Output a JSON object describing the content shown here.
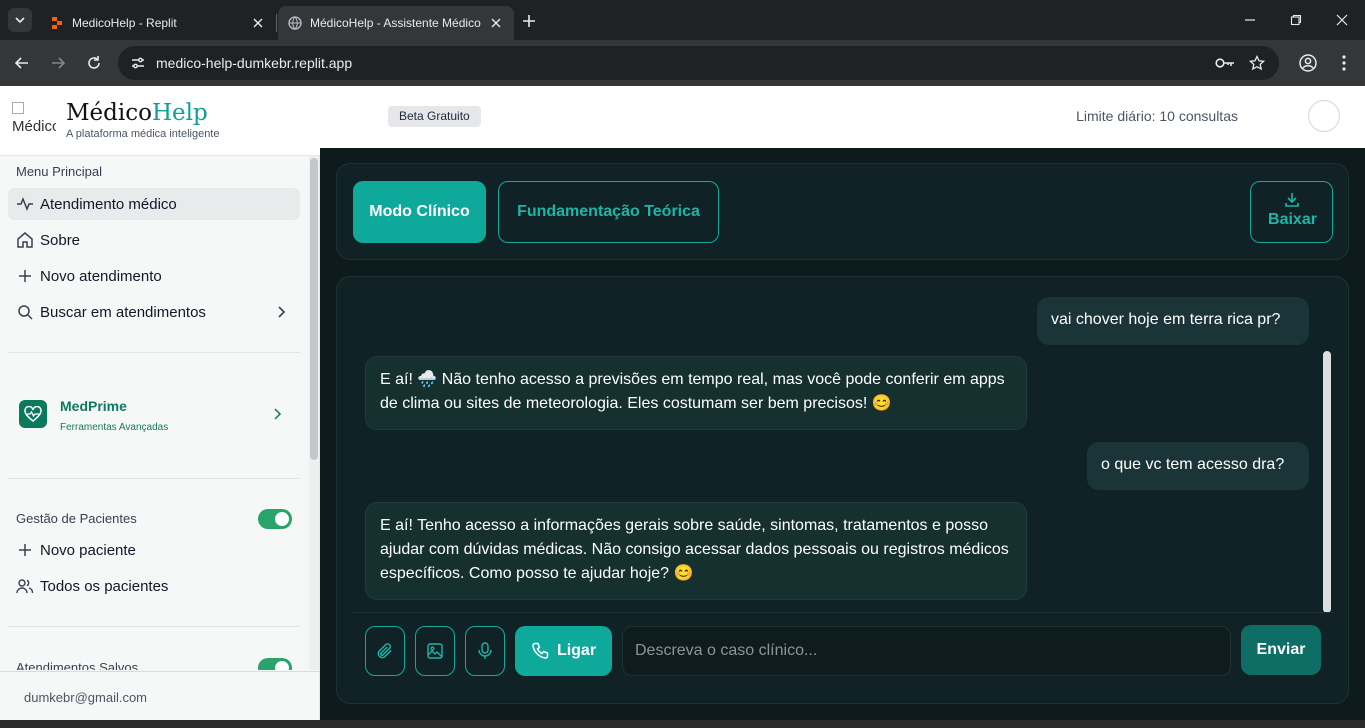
{
  "browser": {
    "tabs": [
      {
        "title": "MedicoHelp - Replit",
        "active": false
      },
      {
        "title": "MédicoHelp - Assistente Médico",
        "active": true
      }
    ],
    "url": "medico-help-dumkebr.replit.app"
  },
  "sidebar": {
    "logo_alt": "Médico",
    "brand_name_part1": "Médico",
    "brand_name_part2": "Help",
    "brand_tagline": "A plataforma médica inteligente",
    "menu_label": "Menu Principal",
    "menu_items": [
      {
        "label": "Atendimento médico",
        "icon": "activity-icon",
        "active": true
      },
      {
        "label": "Sobre",
        "icon": "home-icon",
        "active": false
      },
      {
        "label": "Novo atendimento",
        "icon": "plus-icon",
        "active": false
      },
      {
        "label": "Buscar em atendimentos",
        "icon": "search-icon",
        "active": false
      }
    ],
    "medprime": {
      "title": "MedPrime",
      "subtitle": "Ferramentas Avançadas"
    },
    "patients_label": "Gestão de Pacientes",
    "patients_toggle": true,
    "patient_items": [
      {
        "label": "Novo paciente",
        "icon": "plus-icon"
      },
      {
        "label": "Todos os pacientes",
        "icon": "users-icon"
      }
    ],
    "saved_label": "Atendimentos Salvos",
    "saved_toggle": true,
    "user_email": "dumkebr@gmail.com"
  },
  "topbar": {
    "badge": "Beta Gratuito",
    "limit": "Limite diário: 10 consultas"
  },
  "modes": {
    "clinical": "Modo Clínico",
    "theory": "Fundamentação Teórica",
    "download": "Baixar"
  },
  "messages": [
    {
      "role": "user",
      "text": "vai chover hoje em terra rica pr?"
    },
    {
      "role": "assistant",
      "text": "E aí! 🌧️ Não tenho acesso a previsões em tempo real, mas você pode conferir em apps de clima ou sites de meteorologia. Eles costumam ser bem precisos! 😊"
    },
    {
      "role": "user",
      "text": "o que vc tem acesso dra?"
    },
    {
      "role": "assistant",
      "text": "E aí! Tenho acesso a informações gerais sobre saúde, sintomas, tratamentos e posso ajudar com dúvidas médicas. Não consigo acessar dados pessoais ou registros médicos específicos. Como posso te ajudar hoje? 😊"
    }
  ],
  "composer": {
    "call_label": "Ligar",
    "placeholder": "Descreva o caso clínico...",
    "send_label": "Enviar"
  },
  "colors": {
    "accent": "#0fa99c",
    "dark_bg": "#0e1b1d",
    "toggle_on": "#29a36a"
  }
}
